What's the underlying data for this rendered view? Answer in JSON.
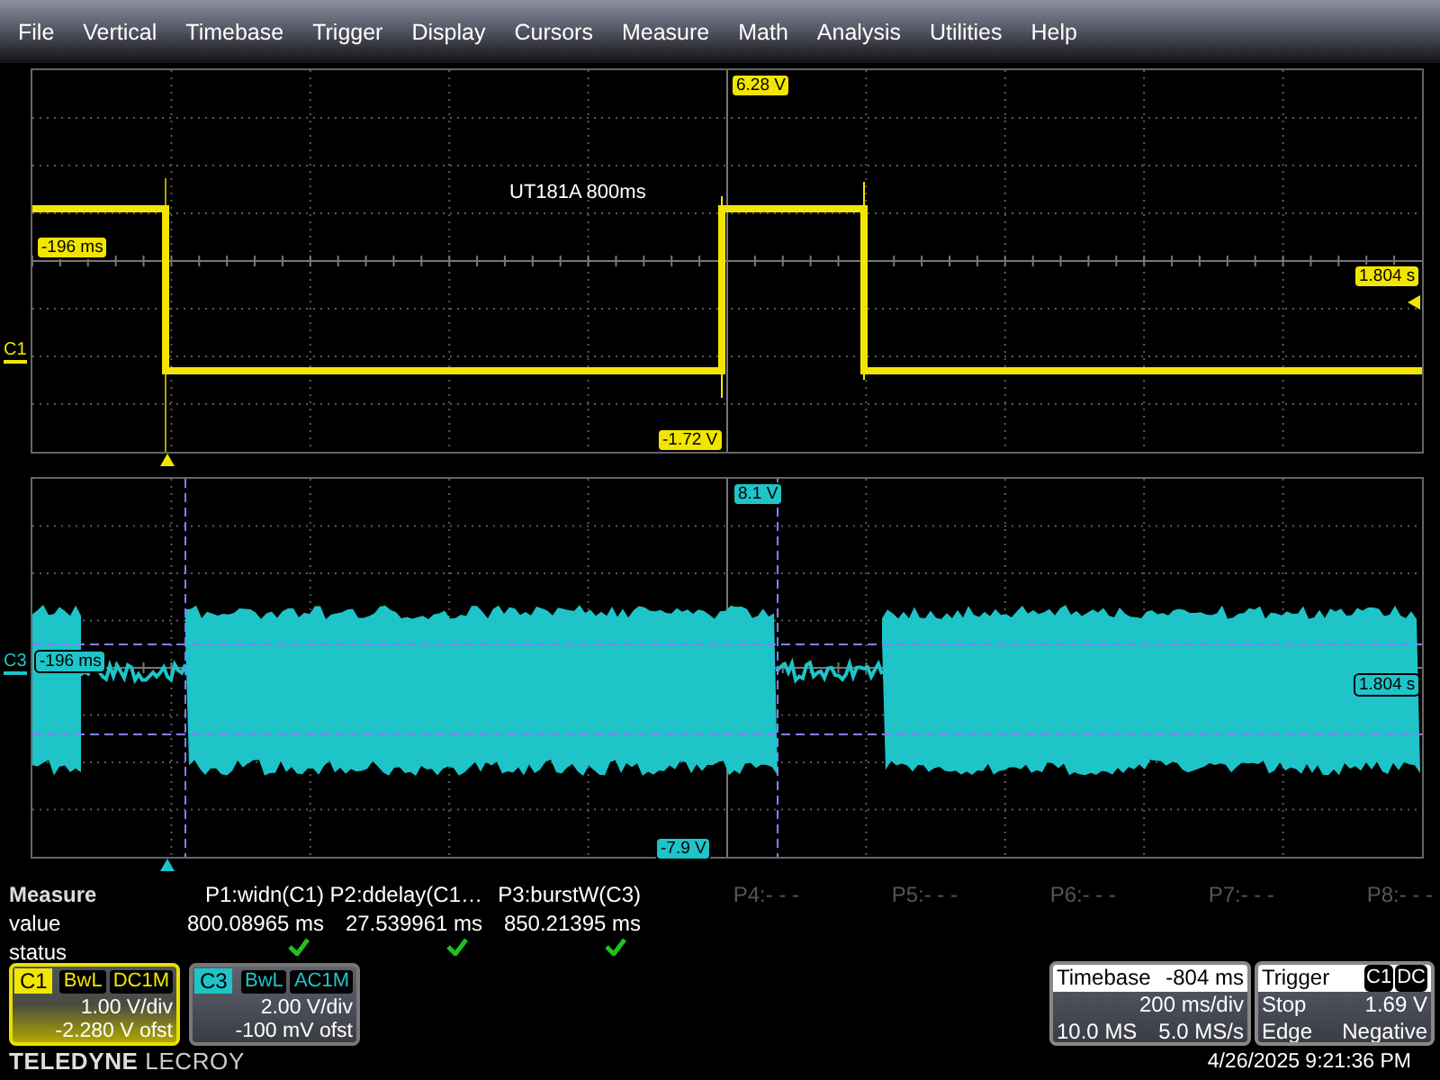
{
  "menu": [
    "File",
    "Vertical",
    "Timebase",
    "Trigger",
    "Display",
    "Cursors",
    "Measure",
    "Math",
    "Analysis",
    "Utilities",
    "Help"
  ],
  "panels": [
    {
      "channel": "C1",
      "color": "#f2e600",
      "kind": "square",
      "annotation": "UT181A 800ms",
      "top_readout": "6.28 V",
      "bottom_readout": "-1.72 V",
      "left_readout": "-196 ms",
      "right_readout": "1.804 s"
    },
    {
      "channel": "C3",
      "color": "#1ec4c8",
      "kind": "burst",
      "top_readout": "8.1 V",
      "bottom_readout": "-7.9 V",
      "left_readout": "-196 ms",
      "right_readout": "1.804 s"
    }
  ],
  "measure": {
    "title": "Measure",
    "row_labels": [
      "value",
      "status"
    ],
    "params": [
      {
        "label": "P1:widn(C1)",
        "value": "800.08965 ms",
        "status_ok": true,
        "active": true
      },
      {
        "label": "P2:ddelay(C1…",
        "value": "27.539961 ms",
        "status_ok": true,
        "active": true
      },
      {
        "label": "P3:burstW(C3)",
        "value": "850.21395 ms",
        "status_ok": true,
        "active": true
      },
      {
        "label": "P4:- - -",
        "status_ok": false,
        "active": false
      },
      {
        "label": "P5:- - -",
        "status_ok": false,
        "active": false
      },
      {
        "label": "P6:- - -",
        "status_ok": false,
        "active": false
      },
      {
        "label": "P7:- - -",
        "status_ok": false,
        "active": false
      },
      {
        "label": "P8:- - -",
        "status_ok": false,
        "active": false
      }
    ]
  },
  "channels": [
    {
      "label": "C1",
      "color": "#f2e600",
      "selected": true,
      "bandwidth": "BwL",
      "coupling": "DC1M",
      "scale": "1.00 V/div",
      "offset": "-2.280 V ofst"
    },
    {
      "label": "C3",
      "color": "#1ec4c8",
      "selected": false,
      "bandwidth": "BwL",
      "coupling": "AC1M",
      "scale": "2.00 V/div",
      "offset": "-100 mV ofst"
    }
  ],
  "logo": "**TELEDYNE** LECROY",
  "timebase": {
    "title": "Timebase",
    "delay": "-804 ms",
    "scale": "200 ms/div",
    "samples": "10.0 MS",
    "rate": "5.0 MS/s"
  },
  "trigger": {
    "title": "Trigger",
    "source": "C1",
    "coupling": "DC",
    "mode": "Stop",
    "level": "1.69 V",
    "type": "Edge",
    "slope": "Negative"
  },
  "datetime": "4/26/2025 9:21:36 PM"
}
